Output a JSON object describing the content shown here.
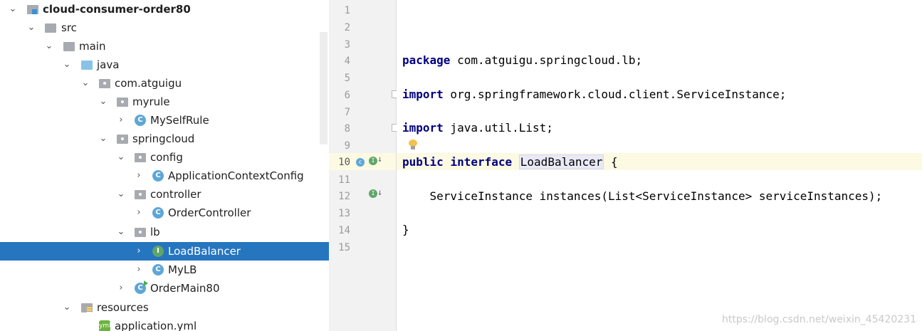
{
  "tree": {
    "rows": [
      {
        "label": "cloud-consumer-order80",
        "arrow": "⌄",
        "icon": "module-folder-icon"
      },
      {
        "label": "src",
        "arrow": "⌄",
        "icon": "folder-icon"
      },
      {
        "label": "main",
        "arrow": "⌄",
        "icon": "folder-icon"
      },
      {
        "label": "java",
        "arrow": "⌄",
        "icon": "source-root-folder-icon"
      },
      {
        "label": "com.atguigu",
        "arrow": "⌄",
        "icon": "package-icon"
      },
      {
        "label": "myrule",
        "arrow": "⌄",
        "icon": "package-icon"
      },
      {
        "label": "MySelfRule",
        "arrow": "›",
        "icon": "class-icon",
        "icon_letter": "C"
      },
      {
        "label": "springcloud",
        "arrow": "⌄",
        "icon": "package-icon"
      },
      {
        "label": "config",
        "arrow": "⌄",
        "icon": "package-icon"
      },
      {
        "label": "ApplicationContextConfig",
        "arrow": "›",
        "icon": "class-icon",
        "icon_letter": "C"
      },
      {
        "label": "controller",
        "arrow": "⌄",
        "icon": "package-icon"
      },
      {
        "label": "OrderController",
        "arrow": "›",
        "icon": "class-icon",
        "icon_letter": "C"
      },
      {
        "label": "lb",
        "arrow": "⌄",
        "icon": "package-icon"
      },
      {
        "label": "LoadBalancer",
        "arrow": "›",
        "icon": "interface-icon",
        "icon_letter": "I"
      },
      {
        "label": "MyLB",
        "arrow": "›",
        "icon": "class-icon",
        "icon_letter": "C"
      },
      {
        "label": "OrderMain80",
        "arrow": "›",
        "icon": "main-class-icon",
        "icon_letter": "C"
      },
      {
        "label": "resources",
        "arrow": "⌄",
        "icon": "resources-folder-icon"
      },
      {
        "label": "application.yml",
        "arrow": "",
        "icon": "yml-file-icon",
        "icon_letter": "yml"
      }
    ]
  },
  "gutter": {
    "line_numbers": [
      "1",
      "2",
      "3",
      "4",
      "5",
      "6",
      "7",
      "8",
      "9",
      "10",
      "11",
      "12",
      "13",
      "14",
      "15"
    ],
    "current_line": "10",
    "line10_icons": [
      "implemented-class-icon",
      "implemented-interface-icon",
      "down-arrow-icon"
    ],
    "line12_icons": [
      "implemented-interface-icon",
      "down-arrow-icon"
    ]
  },
  "editor": {
    "line4_kw": "package",
    "line4_rest": " com.atguigu.springcloud.lb;",
    "line6_kw": "import",
    "line6_rest": " org.springframework.cloud.client.ServiceInstance;",
    "line8_kw": "import",
    "line8_rest": " java.util.List;",
    "line10_kw1": "public",
    "line10_kw2": "interface",
    "line10_name": "LoadBalancer",
    "line10_brace": " {",
    "line12": "    ServiceInstance instances(List<ServiceInstance> serviceInstances);",
    "line14": "}"
  },
  "watermark": "https://blog.csdn.net/weixin_45420231",
  "colors": {
    "selection": "#2675bf",
    "keyword": "#000080",
    "current_line": "#fcfae3"
  }
}
